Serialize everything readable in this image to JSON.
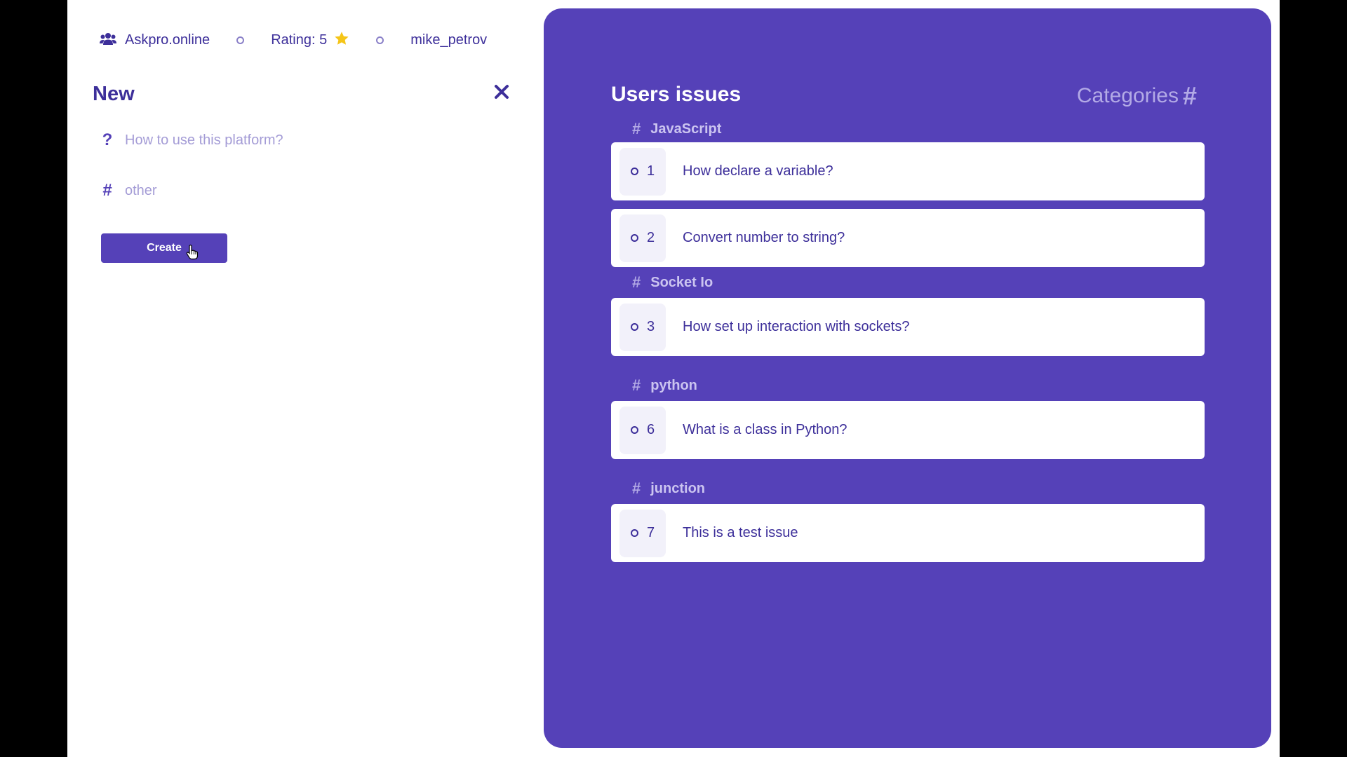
{
  "header": {
    "brand": "Askpro.online",
    "rating": "Rating: 5",
    "username": "mike_petrov"
  },
  "new_issue": {
    "title": "New",
    "question_placeholder": "How to use this platform?",
    "category_placeholder": "other",
    "create_label": "Create"
  },
  "issues_panel": {
    "title": "Users issues",
    "categories_label": "Categories",
    "categories_hash": "#",
    "groups": [
      {
        "category": "JavaScript",
        "issues": [
          {
            "num": "1",
            "text": "How declare a variable?"
          },
          {
            "num": "2",
            "text": "Convert number to string?"
          }
        ]
      },
      {
        "category": "Socket Io",
        "issues": [
          {
            "num": "3",
            "text": "How set up interaction with sockets?"
          }
        ]
      },
      {
        "category": "python",
        "issues": [
          {
            "num": "6",
            "text": "What is a class in Python?"
          }
        ]
      },
      {
        "category": "junction",
        "issues": [
          {
            "num": "7",
            "text": "This is a test issue"
          }
        ]
      }
    ]
  },
  "colors": {
    "accent": "#5541b8",
    "text_dark": "#3d2f9a",
    "muted": "#a49cd6",
    "star": "#f5c518"
  },
  "icons": {
    "brand": "users-icon",
    "rating": "star-icon",
    "close": "close-icon",
    "question": "question-icon",
    "category": "hash-icon"
  }
}
